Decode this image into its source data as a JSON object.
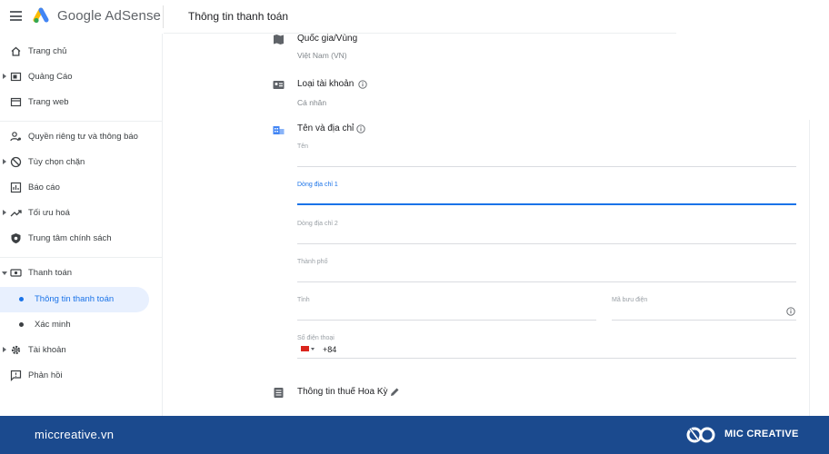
{
  "header": {
    "app_name": "Google AdSense",
    "page_title": "Thông tin thanh toán"
  },
  "sidebar": {
    "items": [
      {
        "label": "Trang chủ",
        "icon": "home-icon"
      },
      {
        "label": "Quảng Cáo",
        "icon": "ads-icon"
      },
      {
        "label": "Trang web",
        "icon": "sites-icon"
      },
      {
        "label": "Quyền riêng tư và thông báo",
        "icon": "privacy-icon"
      },
      {
        "label": "Tùy chọn chặn",
        "icon": "block-icon"
      },
      {
        "label": "Báo cáo",
        "icon": "report-icon"
      },
      {
        "label": "Tối ưu hoá",
        "icon": "optimize-icon"
      },
      {
        "label": "Trung tâm chính sách",
        "icon": "policy-icon"
      },
      {
        "label": "Thanh toán",
        "icon": "payment-icon"
      },
      {
        "label": "Thông tin thanh toán",
        "icon": "dot"
      },
      {
        "label": "Xác minh",
        "icon": "dot"
      },
      {
        "label": "Tài khoản",
        "icon": "gear-icon"
      },
      {
        "label": "Phản hồi",
        "icon": "feedback-icon"
      }
    ]
  },
  "main": {
    "country": {
      "title": "Quốc gia/Vùng",
      "value": "Việt Nam (VN)"
    },
    "account_type": {
      "title": "Loại tài khoản",
      "value": "Cá nhân"
    },
    "name_address": {
      "title": "Tên và địa chỉ",
      "fields": {
        "name": "Tên",
        "address1": "Dòng địa chỉ 1",
        "address2": "Dòng địa chỉ 2",
        "city": "Thành phố",
        "province": "Tỉnh",
        "postal": "Mã bưu điện",
        "phone": "Số điện thoại",
        "phone_prefix": "+84"
      }
    },
    "tax": {
      "title": "Thông tin thuế Hoa Kỳ"
    }
  },
  "footer": {
    "site": "miccreative.vn",
    "brand": "MIC CREATIVE"
  },
  "colors": {
    "accent": "#1a73e8",
    "footer_bg": "#1b4a8e",
    "active_bg": "#e8f0fe"
  }
}
